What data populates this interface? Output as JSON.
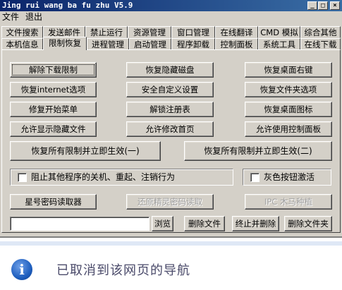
{
  "window": {
    "title": "Jing rui wang ba fu zhu V5.9",
    "controls": {
      "minimize": "_",
      "maximize": "□",
      "close": "×"
    }
  },
  "menu": [
    "文件",
    "退出"
  ],
  "tabs_row1": [
    "文件搜索",
    "发送邮件",
    "禁止运行",
    "资源管理",
    "窗口管理",
    "在线翻译",
    "CMD 模拟",
    "综合其他"
  ],
  "tabs_row2": [
    "本机信息",
    "限制恢复",
    "进程管理",
    "启动管理",
    "程序卸载",
    "控制面板",
    "系统工具",
    "在线下载"
  ],
  "active_tab": "限制恢复",
  "buttons": {
    "grid": [
      [
        "解除下载限制",
        "恢复隐藏磁盘",
        "恢复桌面右键"
      ],
      [
        "恢复internet选项",
        "安全自定义设置",
        "恢复文件夹选项"
      ],
      [
        "修复开始菜单",
        "解锁注册表",
        "恢复桌面图标"
      ],
      [
        "允许显示隐藏文件",
        "允许修改首页",
        "允许使用控制面板"
      ]
    ],
    "restore_all_1": "恢复所有限制并立即生效(一)",
    "restore_all_2": "恢复所有限制并立即生效(二)"
  },
  "options": {
    "block_shutdown": "阻止其他程序的关机、重起、注销行为",
    "gray_button_activate": "灰色按钮激活"
  },
  "tools": {
    "star_password": "星号密码读取器",
    "restore_jingling": "还原精灵密码读取",
    "ipc_trojan": "IPC 木马种植"
  },
  "file_ops": {
    "path_value": "",
    "browse": "浏览",
    "delete_file": "删除文件",
    "terminate_delete": "终止并删除",
    "delete_folder": "删除文件夹"
  },
  "browser": {
    "message": "已取消到该网页的导航",
    "info_glyph": "i"
  },
  "colors": {
    "titlebar_start": "#0a246a",
    "titlebar_end": "#3a6ea5",
    "face": "#d4d0c8"
  }
}
